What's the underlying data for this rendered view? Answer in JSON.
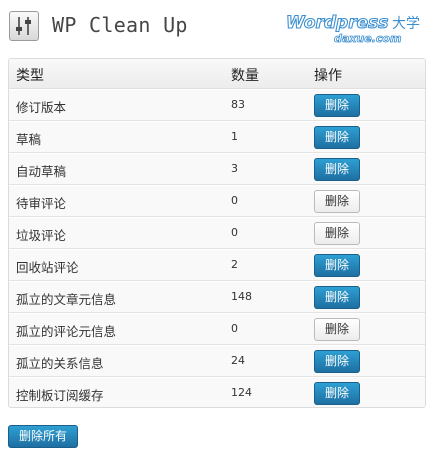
{
  "header": {
    "title": "WP Clean Up",
    "watermark_main": "Wordpress",
    "watermark_cn": "大学",
    "watermark_sub": "daxue.com"
  },
  "table": {
    "headers": {
      "type": "类型",
      "count": "数量",
      "action": "操作"
    },
    "rows": [
      {
        "type": "修订版本",
        "count": "83",
        "action": "删除",
        "style": "primary"
      },
      {
        "type": "草稿",
        "count": "1",
        "action": "删除",
        "style": "primary"
      },
      {
        "type": "自动草稿",
        "count": "3",
        "action": "删除",
        "style": "primary"
      },
      {
        "type": "待审评论",
        "count": "0",
        "action": "删除",
        "style": "secondary"
      },
      {
        "type": "垃圾评论",
        "count": "0",
        "action": "删除",
        "style": "secondary"
      },
      {
        "type": "回收站评论",
        "count": "2",
        "action": "删除",
        "style": "primary"
      },
      {
        "type": "孤立的文章元信息",
        "count": "148",
        "action": "删除",
        "style": "primary"
      },
      {
        "type": "孤立的评论元信息",
        "count": "0",
        "action": "删除",
        "style": "secondary"
      },
      {
        "type": "孤立的关系信息",
        "count": "24",
        "action": "删除",
        "style": "primary"
      },
      {
        "type": "控制板订阅缓存",
        "count": "124",
        "action": "删除",
        "style": "primary"
      }
    ]
  },
  "footer": {
    "delete_all_label": "删除所有"
  },
  "colors": {
    "primary": "#2a8bc2",
    "watermark": "#3b8fd1"
  },
  "icons": {
    "plugin": "plugin-sliders-icon"
  }
}
